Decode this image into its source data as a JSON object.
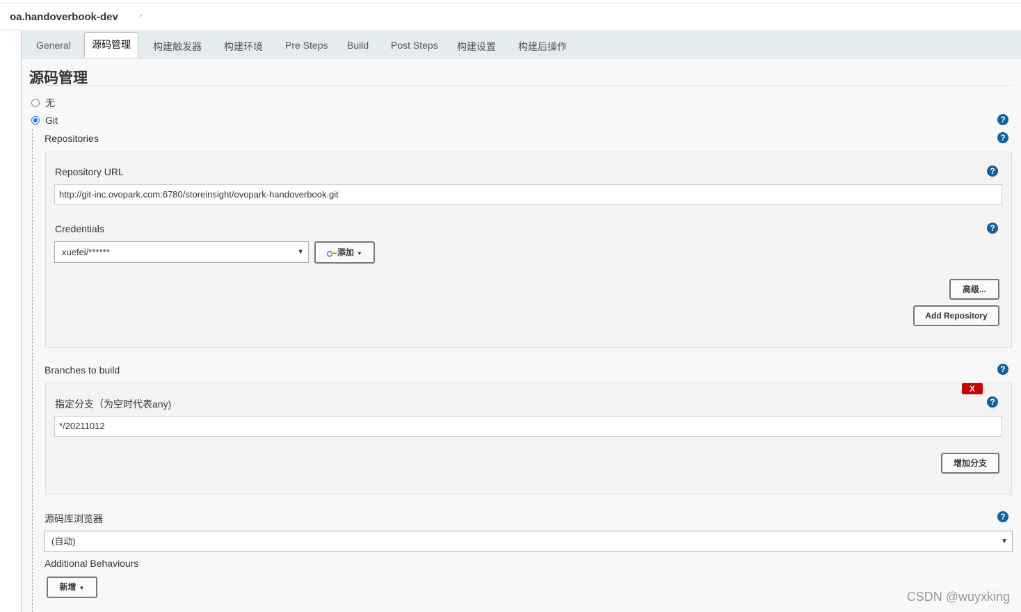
{
  "breadcrumb": {
    "project": "oa.handoverbook-dev",
    "arrow": "›"
  },
  "tabs": [
    {
      "label": "General"
    },
    {
      "label": "源码管理"
    },
    {
      "label": "构建触发器"
    },
    {
      "label": "构建环境"
    },
    {
      "label": "Pre Steps"
    },
    {
      "label": "Build"
    },
    {
      "label": "Post Steps"
    },
    {
      "label": "构建设置"
    },
    {
      "label": "构建后操作"
    }
  ],
  "scm": {
    "title": "源码管理",
    "option_none": "无",
    "option_git": "Git",
    "selected": "Git",
    "repositories_label": "Repositories",
    "repo_url_label": "Repository URL",
    "repo_url_value": "http://git-inc.ovopark.com:6780/storeinsight/ovopark-handoverbook.git",
    "credentials_label": "Credentials",
    "credentials_value": "xuefei/******",
    "add_button": "添加",
    "advanced_button": "高级...",
    "add_repository_button": "Add Repository",
    "branches_label": "Branches to build",
    "delete_label": "X",
    "branch_spec_label": "指定分支（为空时代表any)",
    "branch_spec_value": "*/20211012",
    "add_branch_button": "增加分支",
    "browser_label": "源码库浏览器",
    "browser_value": "(自动)",
    "additional_label": "Additional Behaviours",
    "add_new_button": "新增"
  },
  "help_glyph": "?",
  "watermark": "CSDN @wuyxking",
  "colors": {
    "help": "#0b62a4",
    "radio": "#1a73e8",
    "delete": "#cc0000",
    "tabbar": "#e4ecf0"
  }
}
